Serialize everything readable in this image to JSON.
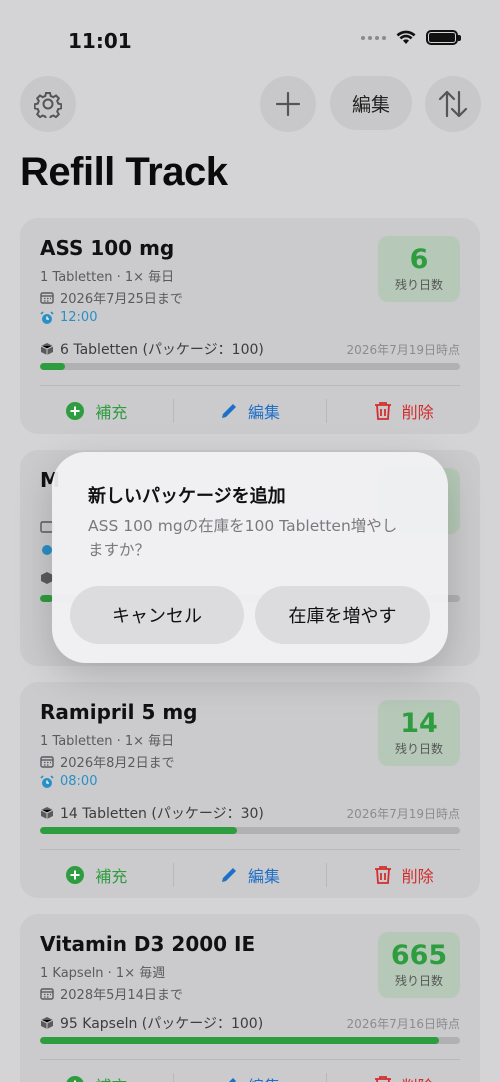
{
  "status": {
    "time": "11:01"
  },
  "header": {
    "edit_label": "編集",
    "title": "Refill Track"
  },
  "cards": [
    {
      "name": "ASS 100 mg",
      "dosage": "1 Tabletten · 1× 毎日",
      "until": "2026年7月25日まで",
      "alarm": "12:00",
      "days": "6",
      "days_label": "残り日数",
      "stock": "6 Tabletten (パッケージ：100)",
      "stock_date": "2026年7月19日時点",
      "progress": 0.06
    },
    {
      "name": "M",
      "progress": 0.03
    },
    {
      "name": "Ramipril 5 mg",
      "dosage": "1 Tabletten · 1× 毎日",
      "until": "2026年8月2日まで",
      "alarm": "08:00",
      "days": "14",
      "days_label": "残り日数",
      "stock": "14 Tabletten (パッケージ：30)",
      "stock_date": "2026年7月19日時点",
      "progress": 0.47
    },
    {
      "name": "Vitamin D3 2000 IE",
      "dosage": "1 Kapseln · 1× 毎週",
      "until": "2028年5月14日まで",
      "days": "665",
      "days_label": "残り日数",
      "stock": "95 Kapseln (パッケージ：100)",
      "stock_date": "2026年7月16日時点",
      "progress": 0.95
    }
  ],
  "actions": {
    "refill": "補充",
    "edit": "編集",
    "delete": "削除"
  },
  "dialog": {
    "title": "新しいパッケージを追加",
    "message": "ASS 100 mgの在庫を100 Tabletten増やしますか？",
    "cancel": "キャンセル",
    "confirm": "在庫を増やす"
  },
  "colors": {
    "green": "#2e9d3f",
    "blue": "#1e6fc9",
    "red": "#d12f2f",
    "alarm": "#2a8fc7"
  }
}
